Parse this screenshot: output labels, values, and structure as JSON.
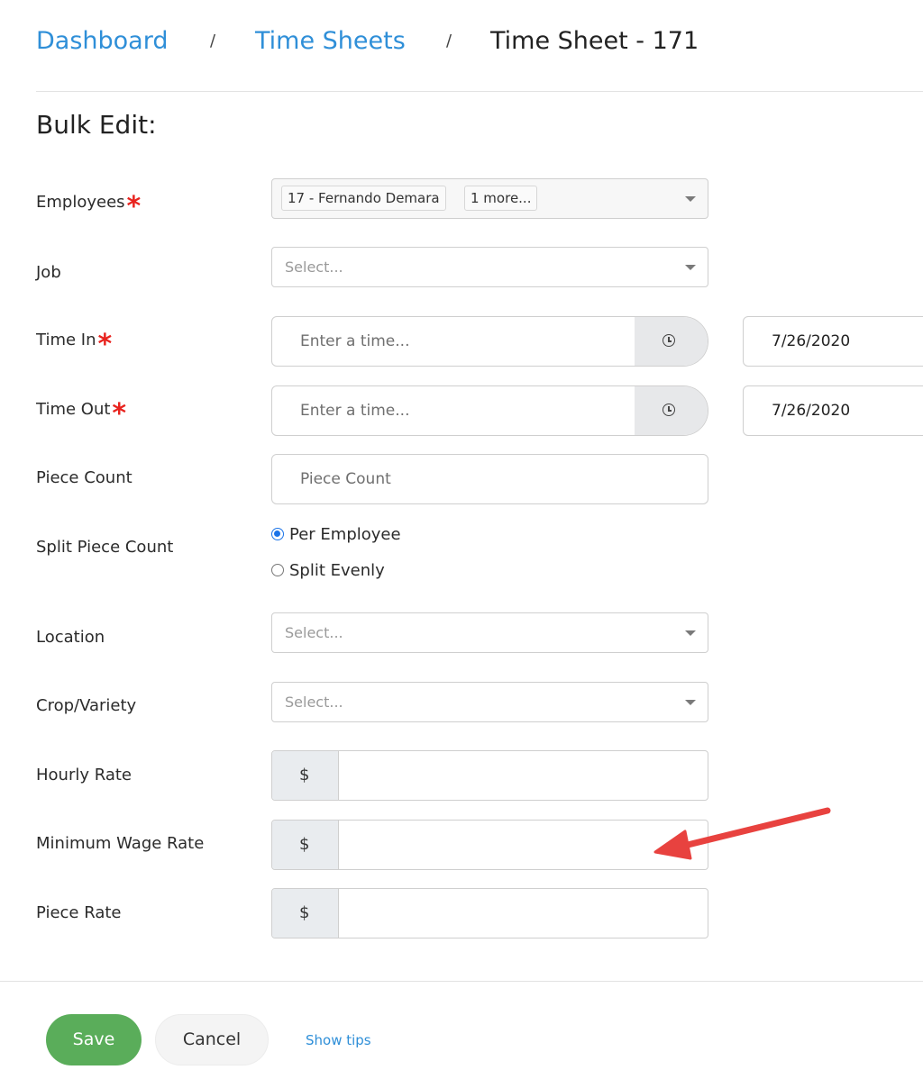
{
  "breadcrumb": {
    "items": [
      "Dashboard",
      "Time Sheets"
    ],
    "separator": "/",
    "current": "Time Sheet - 171"
  },
  "page": {
    "title": "Bulk Edit:"
  },
  "required_mark": "*",
  "form": {
    "employees": {
      "label": "Employees",
      "chips": [
        "17 - Fernando Demara",
        "1 more..."
      ]
    },
    "job": {
      "label": "Job",
      "placeholder": "Select..."
    },
    "time_in": {
      "label": "Time In",
      "placeholder": "Enter a time...",
      "date": "7/26/2020"
    },
    "time_out": {
      "label": "Time Out",
      "placeholder": "Enter a time...",
      "date": "7/26/2020"
    },
    "piece_count": {
      "label": "Piece Count",
      "placeholder": "Piece Count"
    },
    "split_piece_count": {
      "label": "Split Piece Count",
      "options": [
        "Per Employee",
        "Split Evenly"
      ],
      "selected": "Per Employee"
    },
    "location": {
      "label": "Location",
      "placeholder": "Select..."
    },
    "crop_variety": {
      "label": "Crop/Variety",
      "placeholder": "Select..."
    },
    "hourly_rate": {
      "label": "Hourly Rate",
      "currency": "$"
    },
    "minimum_wage_rate": {
      "label": "Minimum Wage Rate",
      "currency": "$"
    },
    "piece_rate": {
      "label": "Piece Rate",
      "currency": "$"
    }
  },
  "footer": {
    "save": "Save",
    "cancel": "Cancel",
    "tips": "Show tips"
  },
  "colors": {
    "link": "#2f8fd8",
    "required": "#e8231e",
    "save": "#5aad5a",
    "annotation_arrow": "#e8423f"
  },
  "icons": {
    "clock": "clock-icon",
    "dropdown": "chevron-down-icon",
    "annotation": "arrow-annotation"
  }
}
